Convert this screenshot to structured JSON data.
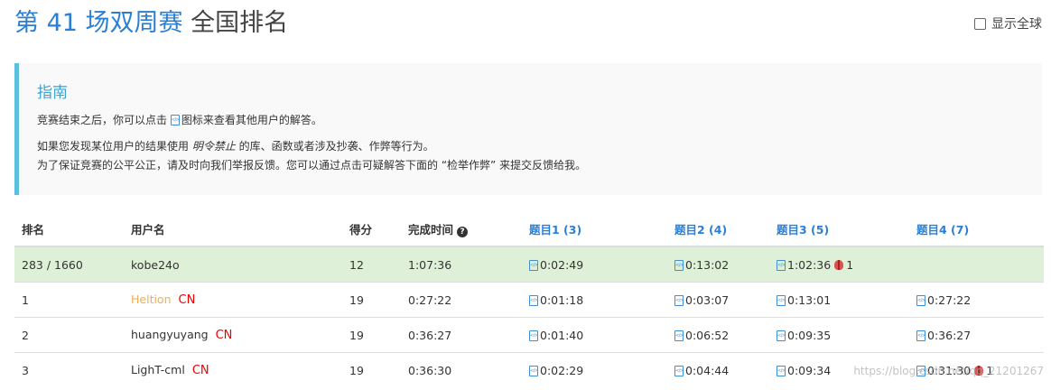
{
  "header": {
    "contest": "第 41 场双周赛",
    "rest": " 全国排名",
    "global_label": "显示全球"
  },
  "guide": {
    "title": "指南",
    "line1_pre": "竞赛结束之后，你可以点击",
    "line1_post": "图标来查看其他用户的解答。",
    "line2_pre": "如果您发现某位用户的结果使用 ",
    "line2_em": "明令禁止",
    "line2_post": " 的库、函数或者涉及抄袭、作弊等行为。",
    "line3": "为了保证竞赛的公平公正，请及时向我们举报反馈。您可以通过点击可疑解答下面的 “检举作弊” 来提交反馈给我。"
  },
  "table": {
    "headers": {
      "rank": "排名",
      "user": "用户名",
      "score": "得分",
      "time": "完成时间",
      "q1": "题目1 (3)",
      "q2": "题目2 (4)",
      "q3": "题目3 (5)",
      "q4": "题目4 (7)"
    },
    "rows": [
      {
        "rank": "283 / 1660",
        "user": "kobe24o",
        "region": "",
        "score": "12",
        "time": "1:07:36",
        "q1": "0:02:49",
        "q2": "0:13:02",
        "q3": "1:02:36",
        "q3_bugs": "1",
        "q4": ""
      },
      {
        "rank": "1",
        "user": "Heltion",
        "region": "CN",
        "score": "19",
        "time": "0:27:22",
        "q1": "0:01:18",
        "q2": "0:03:07",
        "q3": "0:13:01",
        "q4": "0:27:22"
      },
      {
        "rank": "2",
        "user": "huangyuyang",
        "region": "CN",
        "score": "19",
        "time": "0:36:27",
        "q1": "0:01:40",
        "q2": "0:06:52",
        "q3": "0:09:35",
        "q4": "0:36:27"
      },
      {
        "rank": "3",
        "user": "LighT-cml",
        "region": "CN",
        "score": "19",
        "time": "0:36:30",
        "q1": "0:02:29",
        "q2": "0:04:44",
        "q3": "0:09:34",
        "q4": "0:31:30",
        "q4_bugs": "1"
      }
    ]
  },
  "watermark": "https://blog.csdn.net/qq_21201267",
  "colors": {
    "accent": "#2a7fd4",
    "highlight_row": "#dff0d8",
    "cn": "#ee0000",
    "guide_border": "#5bc0de"
  }
}
